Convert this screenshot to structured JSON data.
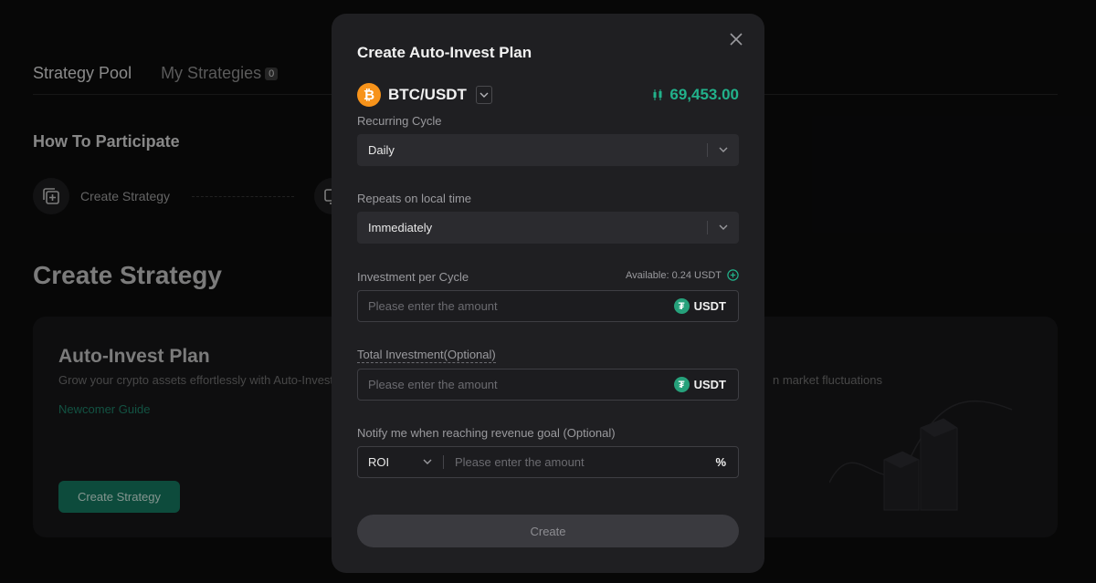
{
  "background": {
    "tabs": [
      {
        "label": "Strategy Pool"
      },
      {
        "label": "My Strategies",
        "badge": "0"
      }
    ],
    "how_to_title": "How To Participate",
    "step1_label": "Create Strategy",
    "section_title": "Create Strategy",
    "card": {
      "title": "Auto-Invest Plan",
      "description": "Grow your crypto assets effortlessly with Auto-Invest",
      "description_right": "n market fluctuations",
      "link": "Newcomer Guide",
      "button": "Create Strategy"
    }
  },
  "modal": {
    "title": "Create Auto-Invest Plan",
    "pair": "BTC/USDT",
    "coin_symbol": "₿",
    "price": "69,453.00",
    "recurring_cycle": {
      "label": "Recurring Cycle",
      "value": "Daily"
    },
    "repeats": {
      "label": "Repeats on local time",
      "value": "Immediately"
    },
    "investment_per_cycle": {
      "label": "Investment per Cycle",
      "available": "Available: 0.24 USDT",
      "placeholder": "Please enter the amount",
      "unit": "USDT"
    },
    "total_investment": {
      "label": "Total Investment(Optional)",
      "placeholder": "Please enter the amount",
      "unit": "USDT"
    },
    "notify": {
      "label": "Notify me when reaching revenue goal (Optional)",
      "type": "ROI",
      "placeholder": "Please enter the amount",
      "unit": "%"
    },
    "create_button": "Create"
  },
  "colors": {
    "accent": "#22b28b",
    "bitcoin": "#f7931a",
    "tether": "#26a17b"
  }
}
